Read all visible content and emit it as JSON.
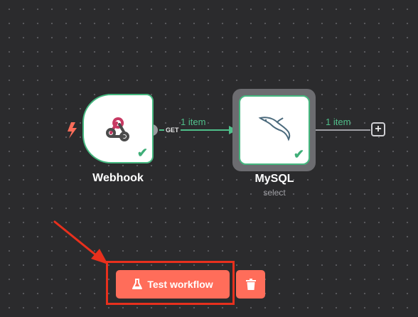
{
  "canvas": {
    "background_color": "#2b2b2d",
    "grid_dot_color": "#5a5a5e"
  },
  "nodes": {
    "webhook": {
      "title": "Webhook",
      "icon": "webhook-icon",
      "trigger_icon": "lightning-bolt-icon",
      "status_icon": "check-icon",
      "status": "✔",
      "output_handle_label": "GET"
    },
    "mysql": {
      "title": "MySQL",
      "subtitle": "select",
      "icon": "mysql-dolphin-icon",
      "status_icon": "check-icon",
      "status": "✔"
    }
  },
  "edges": {
    "webhook_to_mysql": {
      "label": "1 item"
    },
    "mysql_output": {
      "label": "1 item"
    }
  },
  "add_node_button": {
    "label": "+"
  },
  "toolbar": {
    "test_workflow_label": "Test workflow",
    "test_workflow_icon": "flask-icon",
    "delete_icon": "trash-icon"
  },
  "colors": {
    "success": "#45b77f",
    "accent": "#ff6d5a",
    "annotation": "#e8301d",
    "node_selected_frame": "#6c6c70"
  }
}
